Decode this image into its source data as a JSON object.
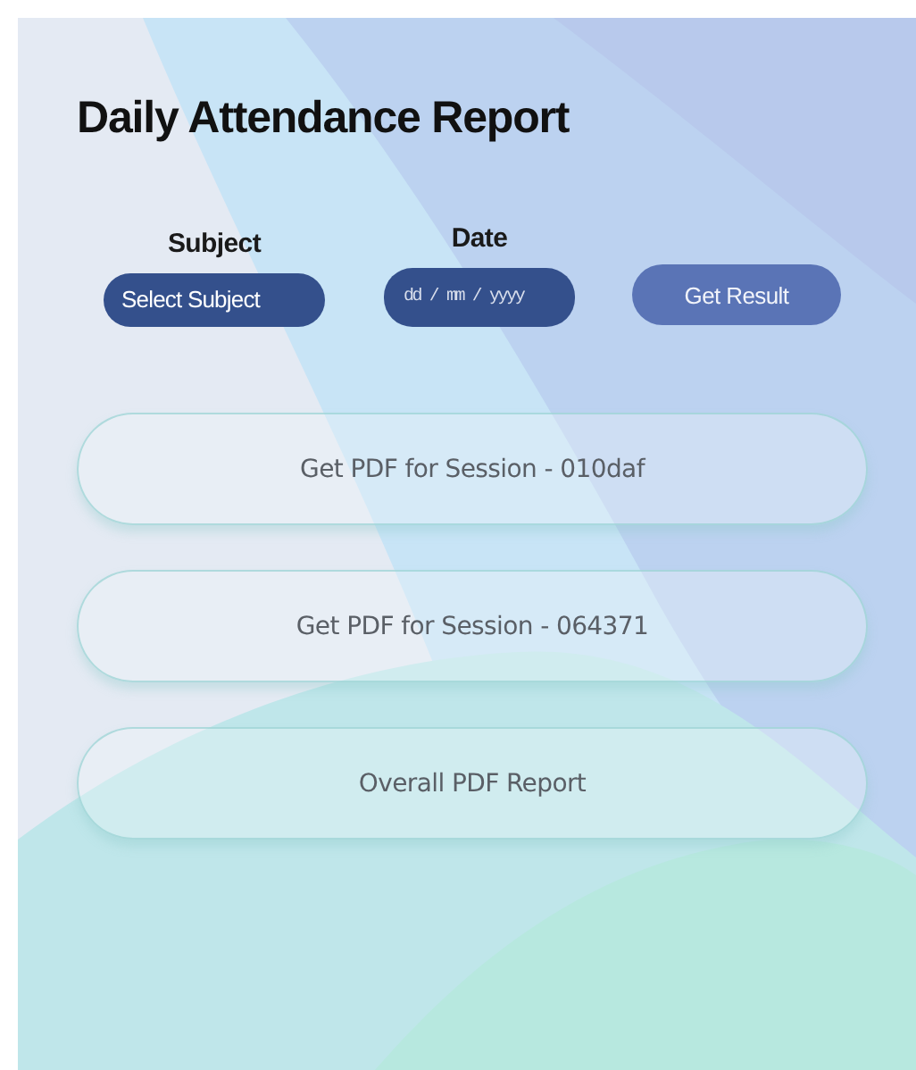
{
  "title": "Daily Attendance Report",
  "filters": [
    {
      "kind": "select",
      "label": "Subject",
      "value": "Select Subject"
    },
    {
      "kind": "date",
      "label": "Date",
      "placeholder": "dd / mm / yyyy"
    }
  ],
  "submit_button": "Get Result",
  "report_buttons": [
    "Get PDF for Session - 010daf",
    "Get PDF for Session - 064371",
    "Overall PDF Report"
  ]
}
